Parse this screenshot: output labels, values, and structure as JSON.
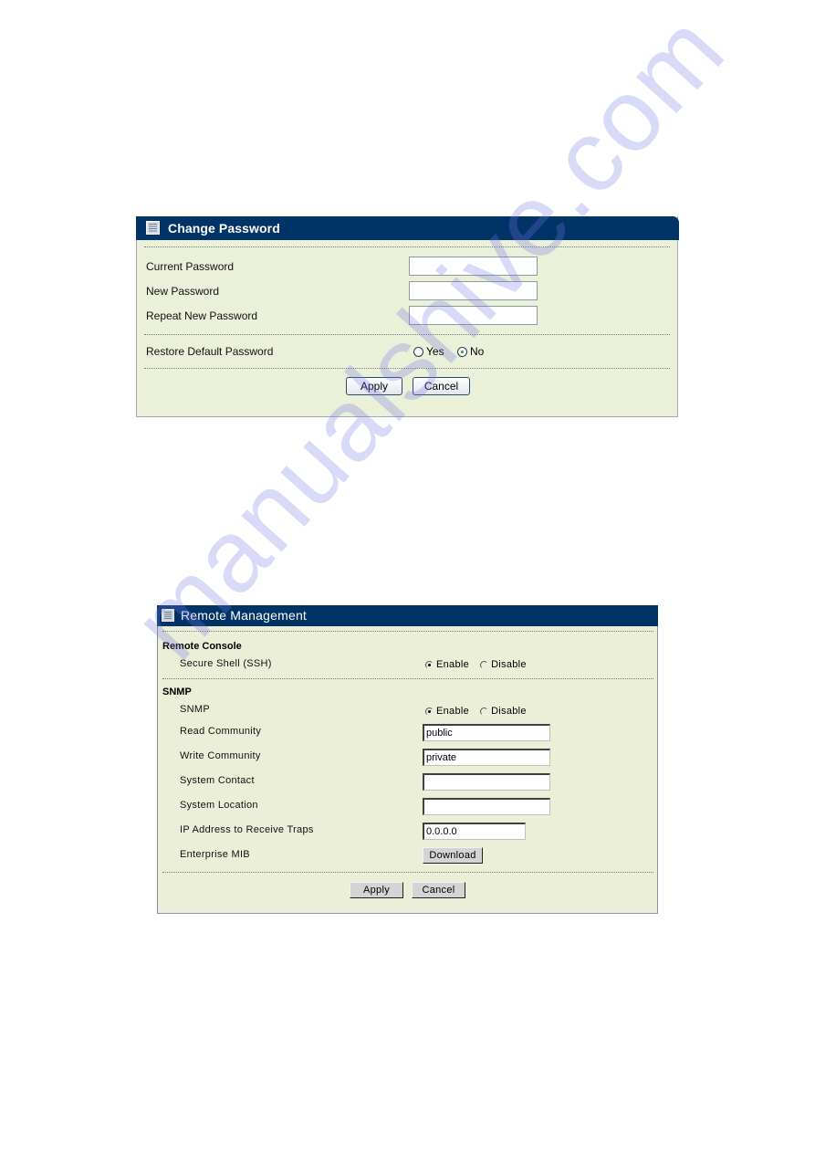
{
  "change_password": {
    "title": "Change Password",
    "icon": "document-list-icon",
    "fields": [
      {
        "label": "Current Password",
        "value": ""
      },
      {
        "label": "New Password",
        "value": ""
      },
      {
        "label": "Repeat New Password",
        "value": ""
      }
    ],
    "restore_default": {
      "label": "Restore Default Password",
      "options": [
        "Yes",
        "No"
      ],
      "selected": "No"
    },
    "buttons": {
      "apply": "Apply",
      "cancel": "Cancel"
    }
  },
  "remote_management": {
    "title": "Remote Management",
    "icon": "document-list-icon",
    "remote_console": {
      "section": "Remote Console",
      "ssh": {
        "label": "Secure Shell (SSH)",
        "options": [
          "Enable",
          "Disable"
        ],
        "selected": "Enable"
      }
    },
    "snmp": {
      "section": "SNMP",
      "snmp_toggle": {
        "label": "SNMP",
        "options": [
          "Enable",
          "Disable"
        ],
        "selected": "Enable"
      },
      "read_community": {
        "label": "Read Community",
        "value": "public"
      },
      "write_community": {
        "label": "Write Community",
        "value": "private"
      },
      "system_contact": {
        "label": "System Contact",
        "value": ""
      },
      "system_location": {
        "label": "System Location",
        "value": ""
      },
      "trap_ip": {
        "label": "IP Address to Receive Traps",
        "value": "0.0.0.0"
      },
      "enterprise_mib": {
        "label": "Enterprise MIB",
        "button": "Download"
      }
    },
    "buttons": {
      "apply": "Apply",
      "cancel": "Cancel"
    }
  },
  "watermark": "manualshive.com",
  "colors": {
    "header_bg": "#003366",
    "panel_bg": "#ebf0d9",
    "header_text": "#ffffff",
    "radio_selected_dot": "#2ea43b"
  }
}
